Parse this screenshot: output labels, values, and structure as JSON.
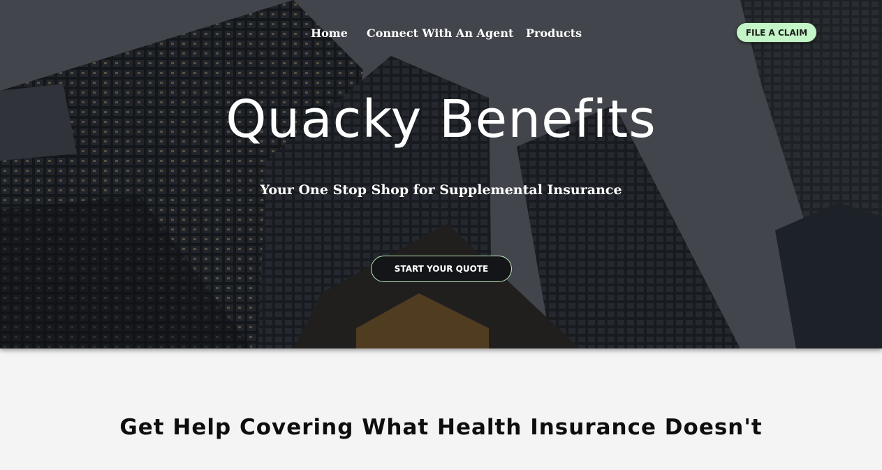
{
  "nav": {
    "links": [
      {
        "label": "Home"
      },
      {
        "label": "Connect With An Agent"
      },
      {
        "label": "Products"
      }
    ],
    "claim_button": "FILE A CLAIM"
  },
  "hero": {
    "title": "Quacky Benefits",
    "subtitle": "Your One Stop Shop for Supplemental Insurance",
    "cta_button": "START YOUR QUOTE"
  },
  "section": {
    "heading": "Get Help Covering What Health Insurance Doesn't"
  },
  "colors": {
    "claim_button_bg": "#c4f5c8",
    "cta_border": "#b9eab9",
    "page_bg": "#f4f4f4"
  }
}
